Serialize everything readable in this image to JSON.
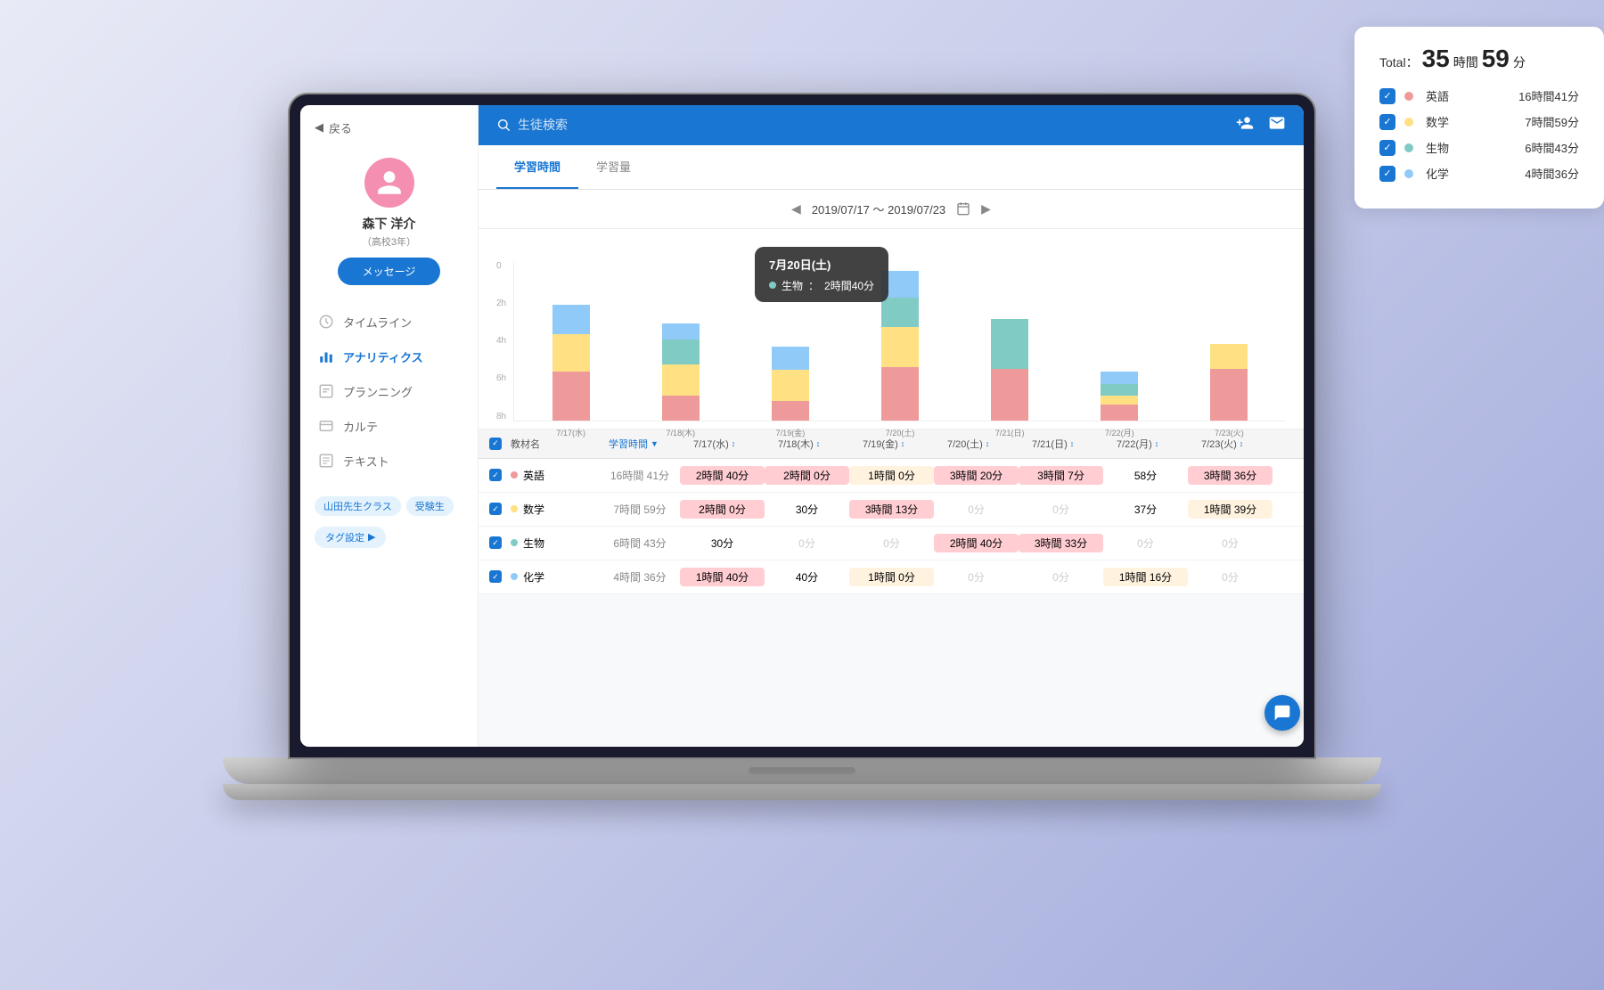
{
  "sidebar": {
    "back_label": "戻る",
    "user": {
      "name": "森下 洋介",
      "grade": "（高校3年）"
    },
    "message_btn": "メッセージ",
    "nav_items": [
      {
        "label": "タイムライン",
        "icon": "clock",
        "active": false
      },
      {
        "label": "アナリティクス",
        "icon": "chart",
        "active": true
      },
      {
        "label": "プランニング",
        "icon": "plan",
        "active": false
      },
      {
        "label": "カルテ",
        "icon": "card",
        "active": false
      },
      {
        "label": "テキスト",
        "icon": "text",
        "active": false
      }
    ],
    "tags": [
      "山田先生クラス",
      "受験生"
    ],
    "tag_settings_btn": "タグ設定"
  },
  "search": {
    "placeholder": "生徒検索"
  },
  "tabs": [
    {
      "label": "学習時間",
      "active": true
    },
    {
      "label": "学習量",
      "active": false
    }
  ],
  "date_range": {
    "text": "2019/07/17 〜 2019/07/23"
  },
  "chart": {
    "y_labels": [
      "8h",
      "6h",
      "4h",
      "2h",
      "0"
    ],
    "days": [
      {
        "label": "7/17(水)",
        "english": 40,
        "math": 55,
        "biology": 0,
        "chemistry": 45
      },
      {
        "label": "7/18(木)",
        "english": 30,
        "math": 45,
        "biology": 35,
        "chemistry": 20
      },
      {
        "label": "7/19(金)",
        "english": 22,
        "math": 38,
        "biology": 0,
        "chemistry": 30
      },
      {
        "label": "7/20(土)",
        "english": 60,
        "math": 50,
        "biology": 38,
        "chemistry": 35
      },
      {
        "label": "7/21(日)",
        "english": 55,
        "math": 0,
        "biology": 55,
        "chemistry": 0
      },
      {
        "label": "7/22(月)",
        "english": 18,
        "math": 10,
        "biology": 15,
        "chemistry": 15
      },
      {
        "label": "7/23(火)",
        "english": 55,
        "math": 26,
        "biology": 0,
        "chemistry": 0
      }
    ],
    "tooltip": {
      "title": "7月20日(土)",
      "subject": "生物",
      "value": "2時間40分",
      "color": "#80cbc4"
    }
  },
  "legend": {
    "total_label": "Total：",
    "total_hours": "35",
    "total_hours_unit": "時間",
    "total_minutes": "59",
    "total_minutes_unit": "分",
    "items": [
      {
        "label": "英語",
        "value": "16時間41分",
        "color": "#ef9a9a"
      },
      {
        "label": "数学",
        "value": "7時間59分",
        "color": "#ffe082"
      },
      {
        "label": "生物",
        "value": "6時間43分",
        "color": "#80cbc4"
      },
      {
        "label": "化学",
        "value": "4時間36分",
        "color": "#90caf9"
      }
    ]
  },
  "table": {
    "headers": {
      "checkbox": "",
      "name": "教材名",
      "time": "学習時間",
      "days": [
        "7/17(水)",
        "7/18(木)",
        "7/19(金)",
        "7/20(土)",
        "7/21(日)",
        "7/22(月)",
        "7/23(火)"
      ]
    },
    "rows": [
      {
        "subject": "英語",
        "color": "#ef9a9a",
        "total": "16時間 41分",
        "days": [
          "2時間 40分",
          "2時間 0分",
          "1時間 0分",
          "3時間 20分",
          "3時間 7分",
          "58分",
          "3時間 36分"
        ],
        "day_levels": [
          "high",
          "high",
          "med",
          "high",
          "high",
          "low",
          "high"
        ]
      },
      {
        "subject": "数学",
        "color": "#ffe082",
        "total": "7時間 59分",
        "days": [
          "2時間 0分",
          "30分",
          "3時間 13分",
          "0分",
          "0分",
          "37分",
          "1時間 39分"
        ],
        "day_levels": [
          "high",
          "low",
          "high",
          "zero",
          "zero",
          "low",
          "med"
        ]
      },
      {
        "subject": "生物",
        "color": "#80cbc4",
        "total": "6時間 43分",
        "days": [
          "30分",
          "0分",
          "0分",
          "2時間 40分",
          "3時間 33分",
          "0分",
          "0分"
        ],
        "day_levels": [
          "low",
          "zero",
          "zero",
          "high",
          "high",
          "zero",
          "zero"
        ]
      },
      {
        "subject": "化学",
        "color": "#90caf9",
        "total": "4時間 36分",
        "days": [
          "1時間 40分",
          "40分",
          "1時間 0分",
          "0分",
          "0分",
          "1時間 16分",
          "0分"
        ],
        "day_levels": [
          "high",
          "low",
          "med",
          "zero",
          "zero",
          "med",
          "zero"
        ]
      }
    ]
  }
}
